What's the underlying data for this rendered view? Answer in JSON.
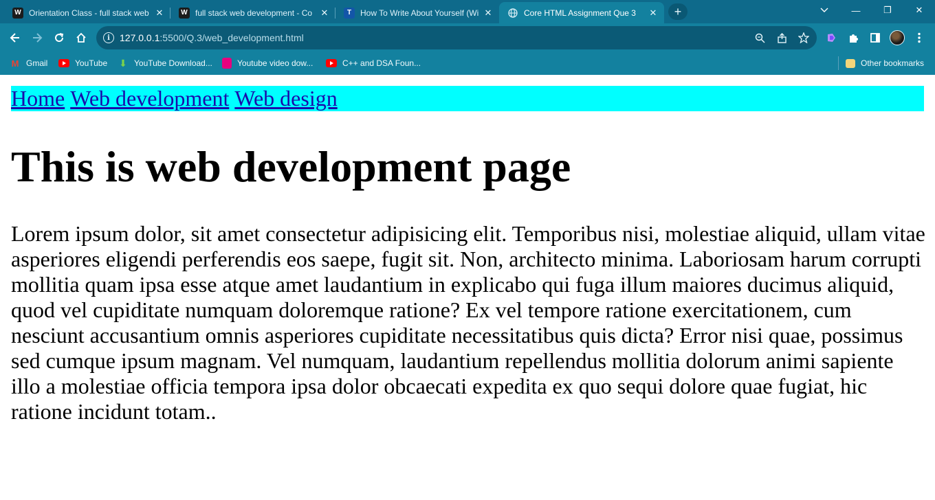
{
  "browser": {
    "tabs": [
      {
        "title": "Orientation Class - full stack web",
        "icon": "wp-icon",
        "active": false
      },
      {
        "title": "full stack web development - Co",
        "icon": "wp-icon",
        "active": false
      },
      {
        "title": "How To Write About Yourself (Wi",
        "icon": "t-icon",
        "active": false
      },
      {
        "title": "Core HTML Assignment Que 3",
        "icon": "globe-icon",
        "active": true
      }
    ],
    "new_tab_symbol": "+",
    "window_controls": {
      "minimize": "—",
      "restore": "❐",
      "close": "✕"
    },
    "address": {
      "host": "127.0.0.1",
      "path": ":5500/Q.3/web_development.html"
    },
    "bookmarks": [
      {
        "label": "Gmail",
        "icon": "gmail-icon"
      },
      {
        "label": "YouTube",
        "icon": "youtube-icon"
      },
      {
        "label": "YouTube Download...",
        "icon": "download-icon"
      },
      {
        "label": "Youtube video dow...",
        "icon": "youtube-video-download-icon"
      },
      {
        "label": "C++ and DSA Foun...",
        "icon": "youtube-icon"
      }
    ],
    "other_bookmarks": "Other bookmarks",
    "colors": {
      "chrome": "#13819f",
      "tabstrip": "#0e6a8b",
      "omnibox": "#0b5a76"
    }
  },
  "page": {
    "nav": [
      "Home",
      "Web development",
      "Web design"
    ],
    "nav_background": "#00ffff",
    "heading": "This is web development page",
    "paragraph": "Lorem ipsum dolor, sit amet consectetur adipisicing elit. Temporibus nisi, molestiae aliquid, ullam vitae asperiores eligendi perferendis eos saepe, fugit sit. Non, architecto minima. Laboriosam harum corrupti mollitia quam ipsa esse atque amet laudantium in explicabo qui fuga illum maiores ducimus aliquid, quod vel cupiditate numquam doloremque ratione? Ex vel tempore ratione exercitationem, cum nesciunt accusantium omnis asperiores cupiditate necessitatibus quis dicta? Error nisi quae, possimus sed cumque ipsum magnam. Vel numquam, laudantium repellendus mollitia dolorum animi sapiente illo a molestiae officia tempora ipsa dolor obcaecati expedita ex quo sequi dolore quae fugiat, hic ratione incidunt totam.."
  }
}
